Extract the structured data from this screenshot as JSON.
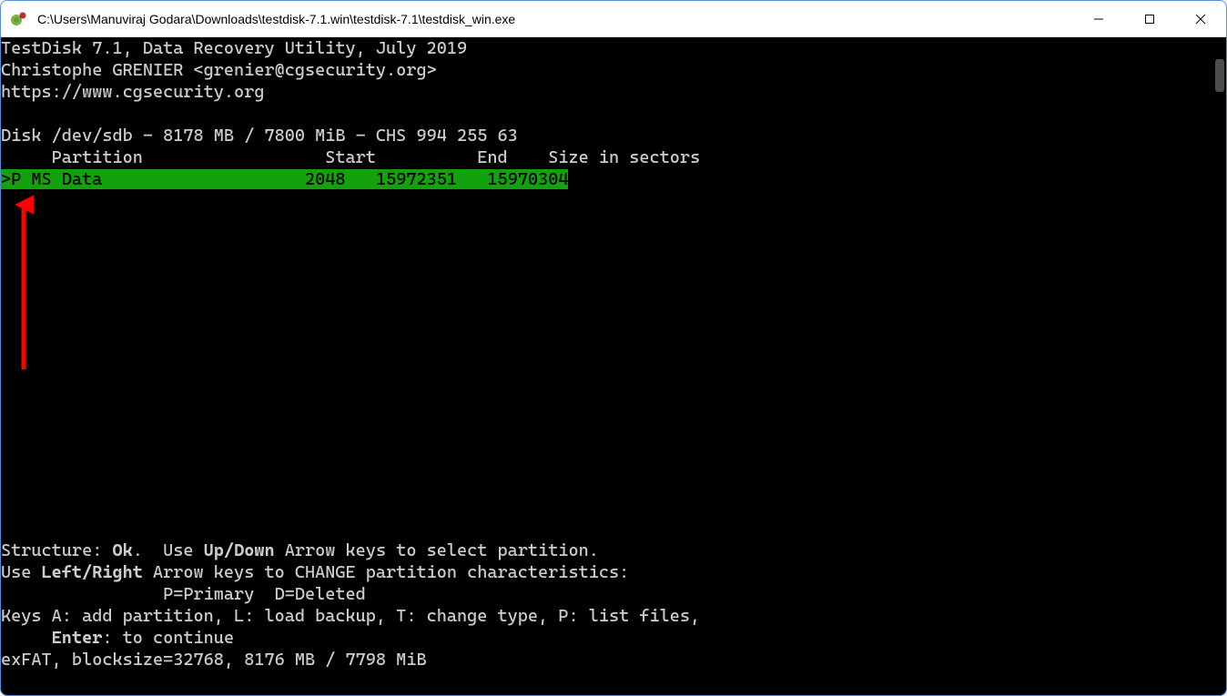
{
  "titlebar": {
    "path": "C:\\Users\\Manuviraj Godara\\Downloads\\testdisk-7.1.win\\testdisk-7.1\\testdisk_win.exe"
  },
  "header": {
    "line1": "TestDisk 7.1, Data Recovery Utility, July 2019",
    "line2": "Christophe GRENIER <grenier@cgsecurity.org>",
    "line3": "https://www.cgsecurity.org"
  },
  "disk": {
    "line": "Disk /dev/sdb - 8178 MB / 7800 MiB - CHS 994 255 63"
  },
  "table": {
    "header": {
      "partition": "Partition",
      "start": "Start",
      "end": "End",
      "size": "Size in sectors"
    },
    "row": {
      "marker": ">",
      "flag": "P",
      "name": "MS Data",
      "start": "2048",
      "end": "15972351",
      "size": "15970304"
    }
  },
  "footer": {
    "struct_prefix": "Structure: ",
    "struct_ok": "Ok",
    "struct_suffix": ".  Use ",
    "updown": "Up/Down",
    "struct_rest": " Arrow keys to select partition.",
    "use": "Use ",
    "leftright": "Left/Right",
    "lr_rest": " Arrow keys to CHANGE partition characteristics:",
    "legend": "                P=Primary  D=Deleted",
    "keys_line": "Keys A: add partition, L: load backup, T: change type, P: list files,",
    "enter_indent": "     ",
    "enter": "Enter",
    "enter_rest": ": to continue",
    "fs_line": "exFAT, blocksize=32768, 8176 MB / 7798 MiB"
  }
}
